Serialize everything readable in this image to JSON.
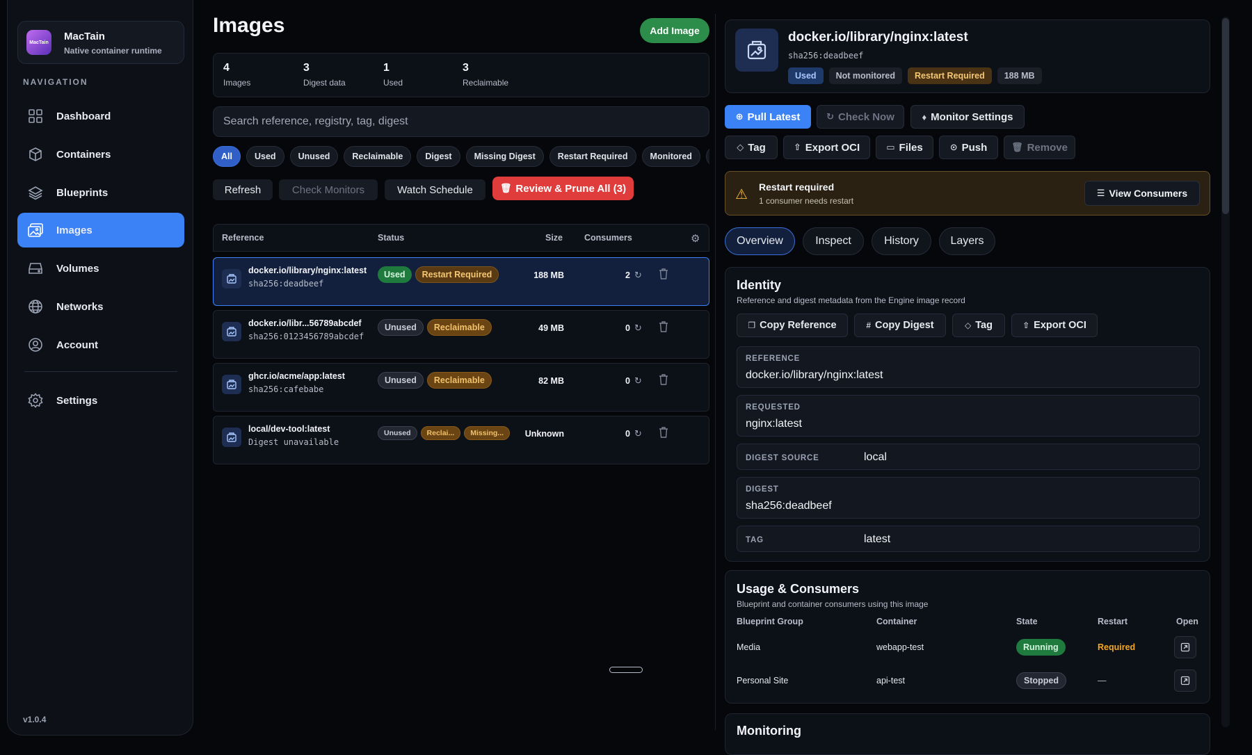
{
  "app": {
    "name": "MacTain",
    "subtitle": "Native container runtime",
    "version": "v1.0.4",
    "logo_text": "MacTain"
  },
  "nav": {
    "heading": "NAVIGATION",
    "items": [
      {
        "label": "Dashboard",
        "icon": "grid-icon"
      },
      {
        "label": "Containers",
        "icon": "box-icon"
      },
      {
        "label": "Blueprints",
        "icon": "layers-icon"
      },
      {
        "label": "Images",
        "icon": "images-icon",
        "active": true
      },
      {
        "label": "Volumes",
        "icon": "drive-icon"
      },
      {
        "label": "Networks",
        "icon": "globe-icon"
      },
      {
        "label": "Account",
        "icon": "user-circle-icon"
      }
    ],
    "settings": "Settings"
  },
  "page": {
    "title": "Images",
    "add_button": "Add Image"
  },
  "stats": [
    {
      "value": "4",
      "label": "Images"
    },
    {
      "value": "3",
      "label": "Digest data"
    },
    {
      "value": "1",
      "label": "Used"
    },
    {
      "value": "3",
      "label": "Reclaimable"
    }
  ],
  "search": {
    "placeholder": "Search reference, registry, tag, digest"
  },
  "filters": [
    "All",
    "Used",
    "Unused",
    "Reclaimable",
    "Digest",
    "Missing Digest",
    "Restart Required",
    "Monitored",
    "U"
  ],
  "toolbar": {
    "refresh": "Refresh",
    "check_monitors": "Check Monitors",
    "watch_schedule": "Watch Schedule",
    "prune": "Review & Prune All (3)"
  },
  "table": {
    "headers": {
      "reference": "Reference",
      "status": "Status",
      "size": "Size",
      "consumers": "Consumers"
    },
    "rows": [
      {
        "name": "docker.io/library/nginx:latest",
        "digest": "sha256:deadbeef",
        "badges": [
          "Used",
          "Restart Required"
        ],
        "size": "188 MB",
        "consumers": "2"
      },
      {
        "name": "docker.io/libr...56789abcdef",
        "digest": "sha256:0123456789abcdef",
        "badges": [
          "Unused",
          "Reclaimable"
        ],
        "size": "49 MB",
        "consumers": "0"
      },
      {
        "name": "ghcr.io/acme/app:latest",
        "digest": "sha256:cafebabe",
        "badges": [
          "Unused",
          "Reclaimable"
        ],
        "size": "82 MB",
        "consumers": "0"
      },
      {
        "name": "local/dev-tool:latest",
        "digest": "Digest unavailable",
        "badges": [
          "Unused",
          "Reclai...",
          "Missing..."
        ],
        "size": "Unknown",
        "consumers": "0"
      }
    ]
  },
  "detail": {
    "title": "docker.io/library/nginx:latest",
    "digest": "sha256:deadbeef",
    "badges": [
      "Used",
      "Not monitored",
      "Restart Required",
      "188 MB"
    ],
    "actions_row1": [
      "Pull Latest",
      "Check Now",
      "Monitor Settings"
    ],
    "actions_row2": [
      "Tag",
      "Export OCI",
      "Files",
      "Push",
      "Remove"
    ],
    "warning": {
      "title": "Restart required",
      "subtitle": "1 consumer needs restart",
      "button": "View Consumers"
    },
    "tabs": [
      "Overview",
      "Inspect",
      "History",
      "Layers"
    ],
    "identity": {
      "title": "Identity",
      "subtitle": "Reference and digest metadata from the Engine image record",
      "buttons": [
        "Copy Reference",
        "Copy Digest",
        "Tag",
        "Export OCI"
      ],
      "fields": [
        {
          "label": "REFERENCE",
          "value": "docker.io/library/nginx:latest"
        },
        {
          "label": "REQUESTED",
          "value": "nginx:latest"
        },
        {
          "label": "DIGEST SOURCE",
          "value": "local"
        },
        {
          "label": "DIGEST",
          "value": "sha256:deadbeef"
        },
        {
          "label": "TAG",
          "value": "latest"
        }
      ]
    },
    "usage": {
      "title": "Usage & Consumers",
      "subtitle": "Blueprint and container consumers using this image",
      "headers": [
        "Blueprint Group",
        "Container",
        "State",
        "Restart",
        "Open"
      ],
      "rows": [
        {
          "group": "Media",
          "container": "webapp-test",
          "state": "Running",
          "restart": "Required"
        },
        {
          "group": "Personal Site",
          "container": "api-test",
          "state": "Stopped",
          "restart": "—"
        }
      ]
    },
    "monitoring_title": "Monitoring"
  },
  "colors": {
    "accent": "#3b82f6",
    "success": "#2c8c4a",
    "danger": "#e03c3c",
    "warning": "#f5b73b"
  }
}
